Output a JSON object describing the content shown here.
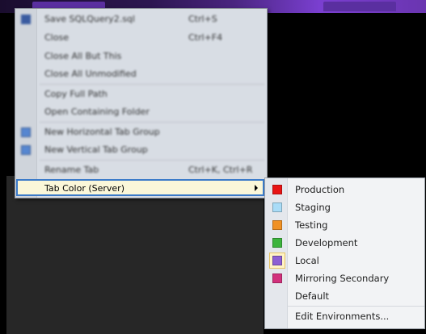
{
  "context_menu": {
    "items": [
      {
        "label": "Save SQLQuery2.sql",
        "shortcut": "Ctrl+S"
      },
      {
        "label": "Close",
        "shortcut": "Ctrl+F4"
      },
      {
        "label": "Close All But This",
        "shortcut": ""
      },
      {
        "label": "Close All Unmodified",
        "shortcut": ""
      },
      {
        "label": "Copy Full Path",
        "shortcut": ""
      },
      {
        "label": "Open Containing Folder",
        "shortcut": ""
      },
      {
        "label": "New Horizontal Tab Group",
        "shortcut": ""
      },
      {
        "label": "New Vertical Tab Group",
        "shortcut": ""
      },
      {
        "label": "Rename Tab",
        "shortcut": "Ctrl+K, Ctrl+R"
      }
    ],
    "tab_color": {
      "label": "Tab Color (Server)"
    }
  },
  "submenu": {
    "items": [
      {
        "label": "Production",
        "color": "#e81414"
      },
      {
        "label": "Staging",
        "color": "#a9dcf7"
      },
      {
        "label": "Testing",
        "color": "#f09124"
      },
      {
        "label": "Development",
        "color": "#3db43d"
      },
      {
        "label": "Local",
        "color": "#8d5fd3",
        "selected": true
      },
      {
        "label": "Mirroring Secondary",
        "color": "#d2307c"
      },
      {
        "label": "Default",
        "color": ""
      }
    ],
    "edit": {
      "label": "Edit Environments..."
    }
  }
}
